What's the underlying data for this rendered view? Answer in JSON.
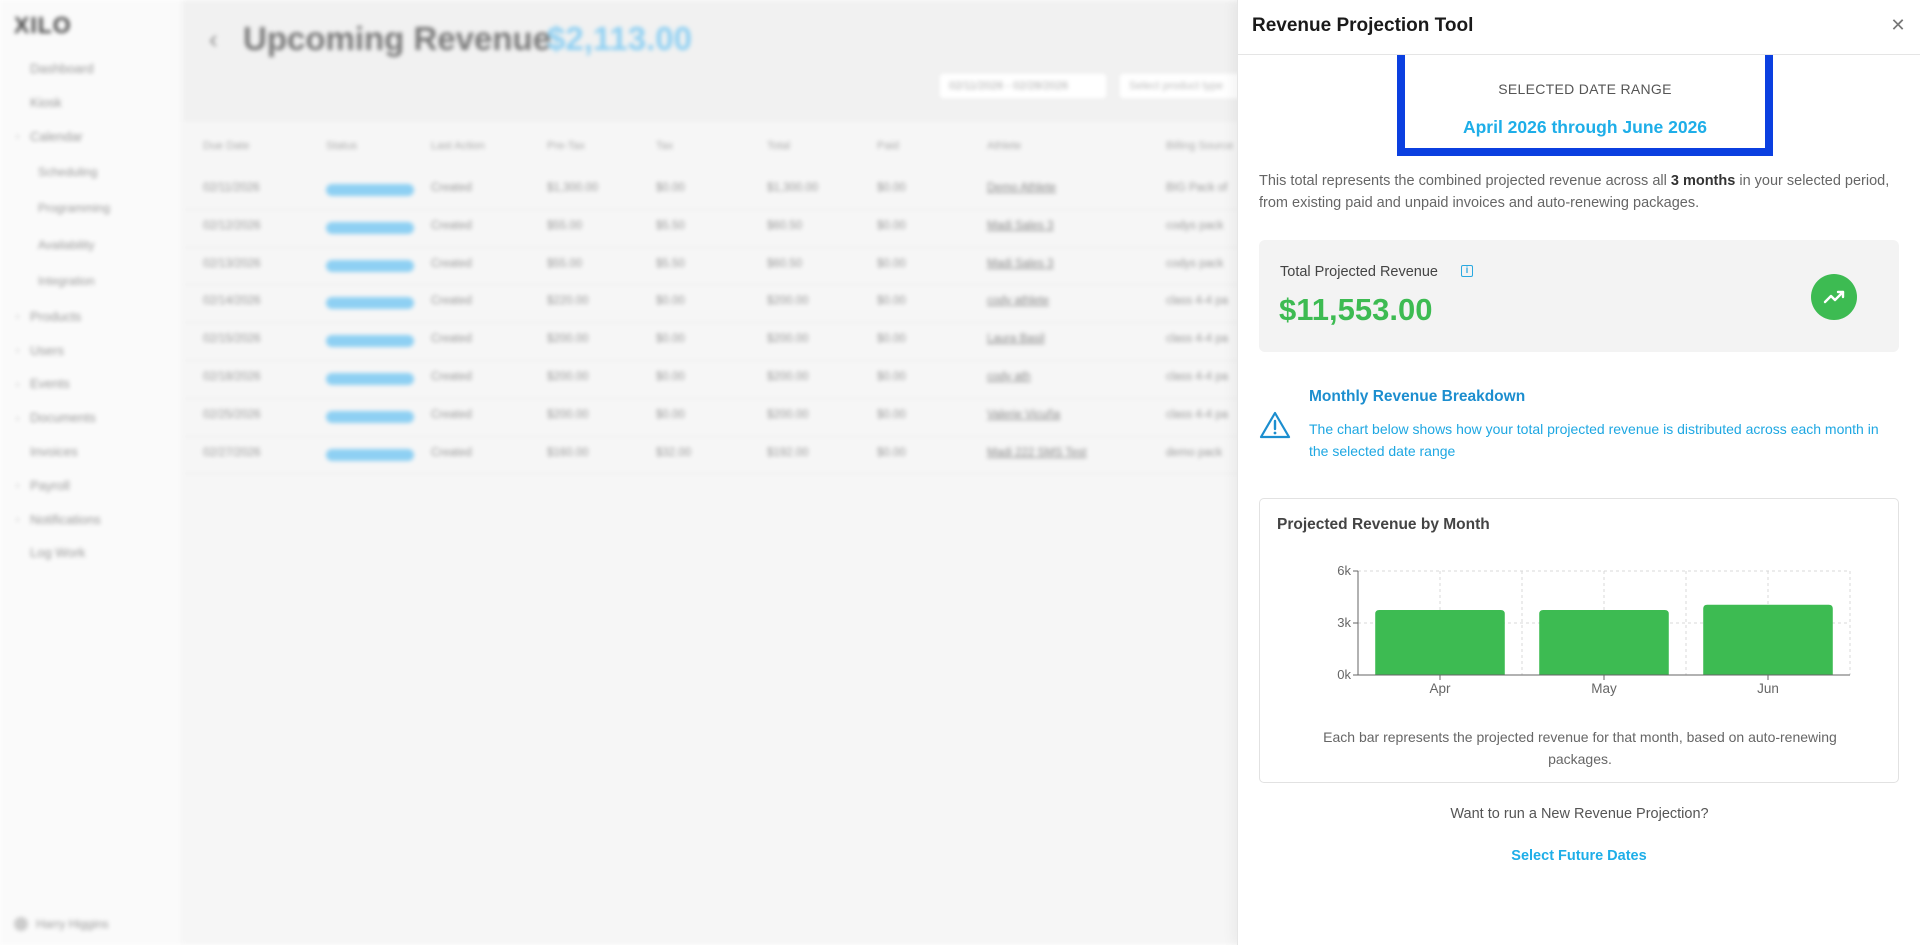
{
  "app": {
    "logo": "XILO",
    "user": "Harry Higgins",
    "sidebar": {
      "items": [
        {
          "label": "Dashboard",
          "sub": false,
          "caret": false
        },
        {
          "label": "Kiosk",
          "sub": false,
          "caret": false
        },
        {
          "label": "Calendar",
          "sub": false,
          "caret": true
        },
        {
          "label": "Scheduling",
          "sub": true,
          "caret": false
        },
        {
          "label": "Programming",
          "sub": true,
          "caret": false
        },
        {
          "label": "Availability",
          "sub": true,
          "caret": false
        },
        {
          "label": "Integration",
          "sub": true,
          "caret": false
        },
        {
          "label": "Products",
          "sub": false,
          "caret": true
        },
        {
          "label": "Users",
          "sub": false,
          "caret": true
        },
        {
          "label": "Events",
          "sub": false,
          "caret": true
        },
        {
          "label": "Documents",
          "sub": false,
          "caret": true
        },
        {
          "label": "Invoices",
          "sub": false,
          "caret": false
        },
        {
          "label": "Payroll",
          "sub": false,
          "caret": true
        },
        {
          "label": "Notifications",
          "sub": false,
          "caret": true
        },
        {
          "label": "Log Work",
          "sub": false,
          "caret": false
        }
      ]
    },
    "page": {
      "title": "Upcoming Revenue",
      "amount": "$2,113.00",
      "date_filter": "02/11/2026 - 02/28/2026",
      "product_select_placeholder": "Select product type"
    },
    "table": {
      "columns": [
        "Due Date",
        "Status",
        "Last Action",
        "Pre-Tax",
        "Tax",
        "Total",
        "Paid",
        "Athlete",
        "Billing Source"
      ],
      "rows": [
        [
          "02/11/2026",
          "UPCOMING",
          "Created",
          "$1,300.00",
          "$0.00",
          "$1,300.00",
          "$0.00",
          "Demo Athlete",
          "BIG Pack of"
        ],
        [
          "02/12/2026",
          "UPCOMING",
          "Created",
          "$55.00",
          "$5.50",
          "$60.50",
          "$0.00",
          "Madi Sales 3",
          "codys pack"
        ],
        [
          "02/13/2026",
          "UPCOMING",
          "Created",
          "$55.00",
          "$5.50",
          "$60.50",
          "$0.00",
          "Madi Sales 3",
          "codys pack"
        ],
        [
          "02/14/2026",
          "UPCOMING",
          "Created",
          "$220.00",
          "$0.00",
          "$200.00",
          "$0.00",
          "cody athlete",
          "class 4-4 pa"
        ],
        [
          "02/15/2026",
          "UPCOMING",
          "Created",
          "$200.00",
          "$0.00",
          "$200.00",
          "$0.00",
          "Laura Basil",
          "class 4-4 pa"
        ],
        [
          "02/18/2026",
          "UPCOMING",
          "Created",
          "$200.00",
          "$0.00",
          "$200.00",
          "$0.00",
          "cody ath",
          "class 4-4 pa"
        ],
        [
          "02/25/2026",
          "UPCOMING",
          "Created",
          "$200.00",
          "$0.00",
          "$200.00",
          "$0.00",
          "Valerie Vicuña",
          "class 4-4 pa"
        ],
        [
          "02/27/2026",
          "UPCOMING",
          "Created",
          "$160.00",
          "$32.00",
          "$192.00",
          "$0.00",
          "Madi 222 SMS Test",
          "demo pack"
        ]
      ]
    }
  },
  "drawer": {
    "title": "Revenue Projection Tool",
    "close_icon": "close-icon",
    "range_label": "SELECTED DATE RANGE",
    "range_value": "April 2026 through June 2026",
    "description": {
      "before": "This total represents the combined projected revenue across all ",
      "bold": "3 months",
      "after": " in your selected period, from existing paid and unpaid invoices and auto-renewing packages."
    },
    "total": {
      "label": "Total Projected Revenue",
      "value": "$11,553.00",
      "info_icon": "info-icon",
      "trend_icon": "trending-up-icon"
    },
    "alert": {
      "icon": "warning-icon",
      "title": "Monthly Revenue Breakdown",
      "text": "The chart below shows how your total projected revenue is distributed across each month in the selected date range"
    },
    "chart": {
      "title": "Projected Revenue by Month",
      "note": "Each bar represents the projected revenue for that month, based on auto-renewing packages."
    },
    "rerun_text": "Want to run a New Revenue Projection?",
    "select_dates_label": "Select Future Dates"
  },
  "colors": {
    "accent": "#1eaee8",
    "success": "#3dbb52",
    "highlight_border": "#0b3fe0"
  },
  "chart_data": {
    "type": "bar",
    "categories": [
      "Apr",
      "May",
      "Jun"
    ],
    "values": [
      3750,
      3750,
      4050
    ],
    "title": "Projected Revenue by Month",
    "xlabel": "",
    "ylabel": "",
    "ylim": [
      0,
      6000
    ],
    "yticks": [
      0,
      3000,
      6000
    ],
    "ytick_labels": [
      "0k",
      "3k",
      "6k"
    ],
    "grid": true,
    "bar_color": "#3dbb52"
  }
}
